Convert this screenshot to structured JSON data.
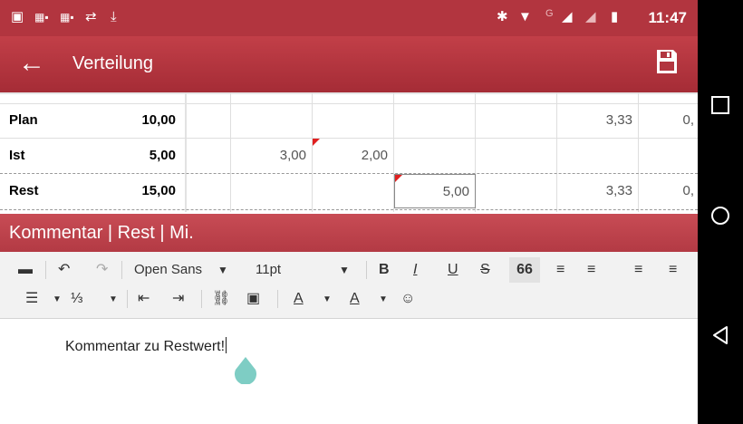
{
  "status_bar": {
    "time": "11:47",
    "icons": [
      "image-icon",
      "office-icon",
      "office-icon",
      "sync-icon",
      "download-icon",
      "bluetooth-icon",
      "wifi-icon",
      "signal-icon",
      "signal-empty-icon",
      "battery-icon"
    ],
    "network_label": "G"
  },
  "app_bar": {
    "title": "Verteilung",
    "back_icon": "arrow-left-icon",
    "save_icon": "floppy-save-icon",
    "color": "#b2353f"
  },
  "grid": {
    "rows": [
      {
        "label": "Plan",
        "total": "10,00",
        "cells": [
          "",
          "",
          "",
          "",
          "",
          "3,33",
          "0,"
        ]
      },
      {
        "label": "Ist",
        "total": "5,00",
        "cells": [
          "",
          "3,00",
          "2,00",
          "",
          "",
          "",
          ""
        ]
      },
      {
        "label": "Rest",
        "total": "15,00",
        "cells": [
          "",
          "",
          "",
          "5,00",
          "",
          "3,33",
          "0,"
        ]
      }
    ]
  },
  "comment_header": "Kommentar | Rest | Mi.",
  "toolbar": {
    "font_family": "Open Sans",
    "font_size": "11pt",
    "bold": "B",
    "italic": "I",
    "underline": "U",
    "strike": "S",
    "quote": "66",
    "font_color_letter": "A",
    "bg_color_letter": "A"
  },
  "editor": {
    "text": "Kommentar zu Restwert!"
  },
  "colors": {
    "accent": "#b2353f",
    "section_header": "#c0464f",
    "cell_marker": "#e02020",
    "text_handle": "#7ecdc4"
  }
}
